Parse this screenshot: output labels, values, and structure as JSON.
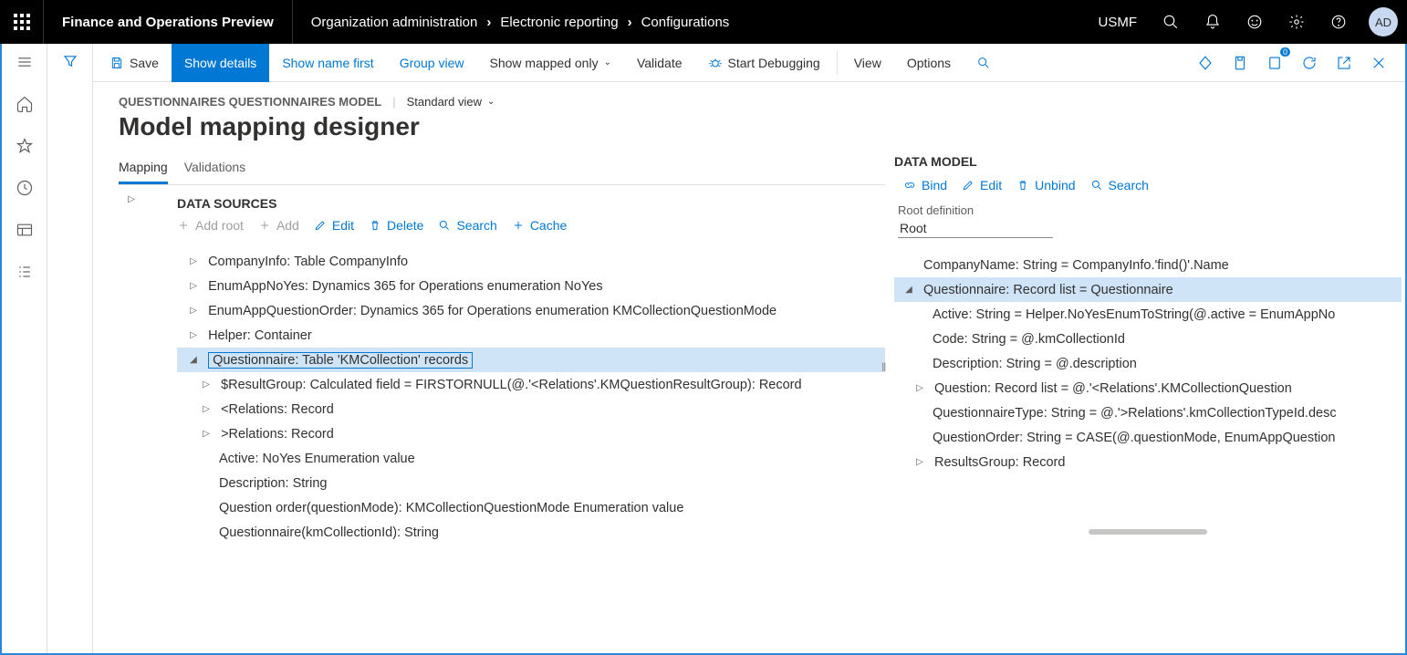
{
  "app": {
    "title": "Finance and Operations Preview"
  },
  "breadcrumbs": [
    "Organization administration",
    "Electronic reporting",
    "Configurations"
  ],
  "top": {
    "company": "USMF",
    "avatar": "AD"
  },
  "cmdbar": {
    "save": "Save",
    "show_details": "Show details",
    "show_name_first": "Show name first",
    "group_view": "Group view",
    "show_mapped_only": "Show mapped only",
    "validate": "Validate",
    "start_debugging": "Start Debugging",
    "view": "View",
    "options": "Options"
  },
  "header": {
    "module": "QUESTIONNAIRES QUESTIONNAIRES MODEL",
    "view": "Standard view",
    "title": "Model mapping designer"
  },
  "tabs": {
    "mapping": "Mapping",
    "validations": "Validations"
  },
  "ds": {
    "title": "DATA SOURCES",
    "add_root": "Add root",
    "add": "Add",
    "edit": "Edit",
    "delete": "Delete",
    "search": "Search",
    "cache": "Cache",
    "nodes": {
      "company": "CompanyInfo: Table CompanyInfo",
      "enum_noyes": "EnumAppNoYes: Dynamics 365 for Operations enumeration NoYes",
      "enum_qorder": "EnumAppQuestionOrder: Dynamics 365 for Operations enumeration KMCollectionQuestionMode",
      "helper": "Helper: Container",
      "questionnaire": "Questionnaire: Table 'KMCollection' records",
      "resultgroup": "$ResultGroup: Calculated field = FIRSTORNULL(@.'<Relations'.KMQuestionResultGroup): Record",
      "lt_rel": "<Relations: Record",
      "gt_rel": ">Relations: Record",
      "active": "Active: NoYes Enumeration value",
      "description": "Description: String",
      "qorder": "Question order(questionMode): KMCollectionQuestionMode Enumeration value",
      "qid": "Questionnaire(kmCollectionId): String"
    }
  },
  "dm": {
    "title": "DATA MODEL",
    "bind": "Bind",
    "edit": "Edit",
    "unbind": "Unbind",
    "search": "Search",
    "rootlabel": "Root definition",
    "rootvalue": "Root",
    "nodes": {
      "company": "CompanyName: String = CompanyInfo.'find()'.Name",
      "questionnaire": "Questionnaire: Record list = Questionnaire",
      "active": "Active: String = Helper.NoYesEnumToString(@.active = EnumAppNo",
      "code": "Code: String = @.kmCollectionId",
      "description": "Description: String = @.description",
      "question": "Question: Record list = @.'<Relations'.KMCollectionQuestion",
      "qtype": "QuestionnaireType: String = @.'>Relations'.kmCollectionTypeId.desc",
      "qorder": "QuestionOrder: String = CASE(@.questionMode, EnumAppQuestion",
      "results": "ResultsGroup: Record"
    }
  }
}
